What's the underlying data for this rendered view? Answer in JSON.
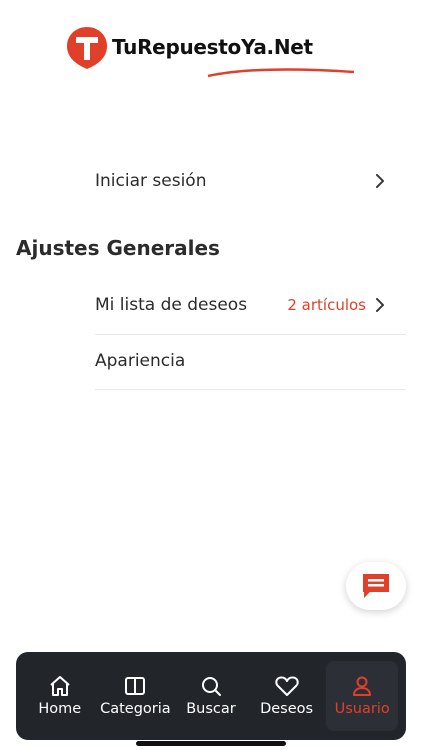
{
  "header": {
    "logo_text": "TuRepuestoYa.Net",
    "logo_icon": "t-badge-icon"
  },
  "account": {
    "login_label": "Iniciar sesión"
  },
  "general_settings": {
    "title": "Ajustes Generales",
    "items": [
      {
        "label": "Mi lista de deseos",
        "value": "2 artículos"
      },
      {
        "label": "Apariencia"
      }
    ]
  },
  "chat": {
    "icon": "chat-icon"
  },
  "tabbar": {
    "items": [
      {
        "label": "Home",
        "icon": "home-icon"
      },
      {
        "label": "Categoria",
        "icon": "book-icon"
      },
      {
        "label": "Buscar",
        "icon": "search-icon"
      },
      {
        "label": "Deseos",
        "icon": "heart-icon"
      },
      {
        "label": "Usuario",
        "icon": "user-icon",
        "active": true
      }
    ]
  },
  "colors": {
    "accent": "#e0402a",
    "tabbar_bg": "#22262b",
    "text": "#2b2b2b"
  }
}
